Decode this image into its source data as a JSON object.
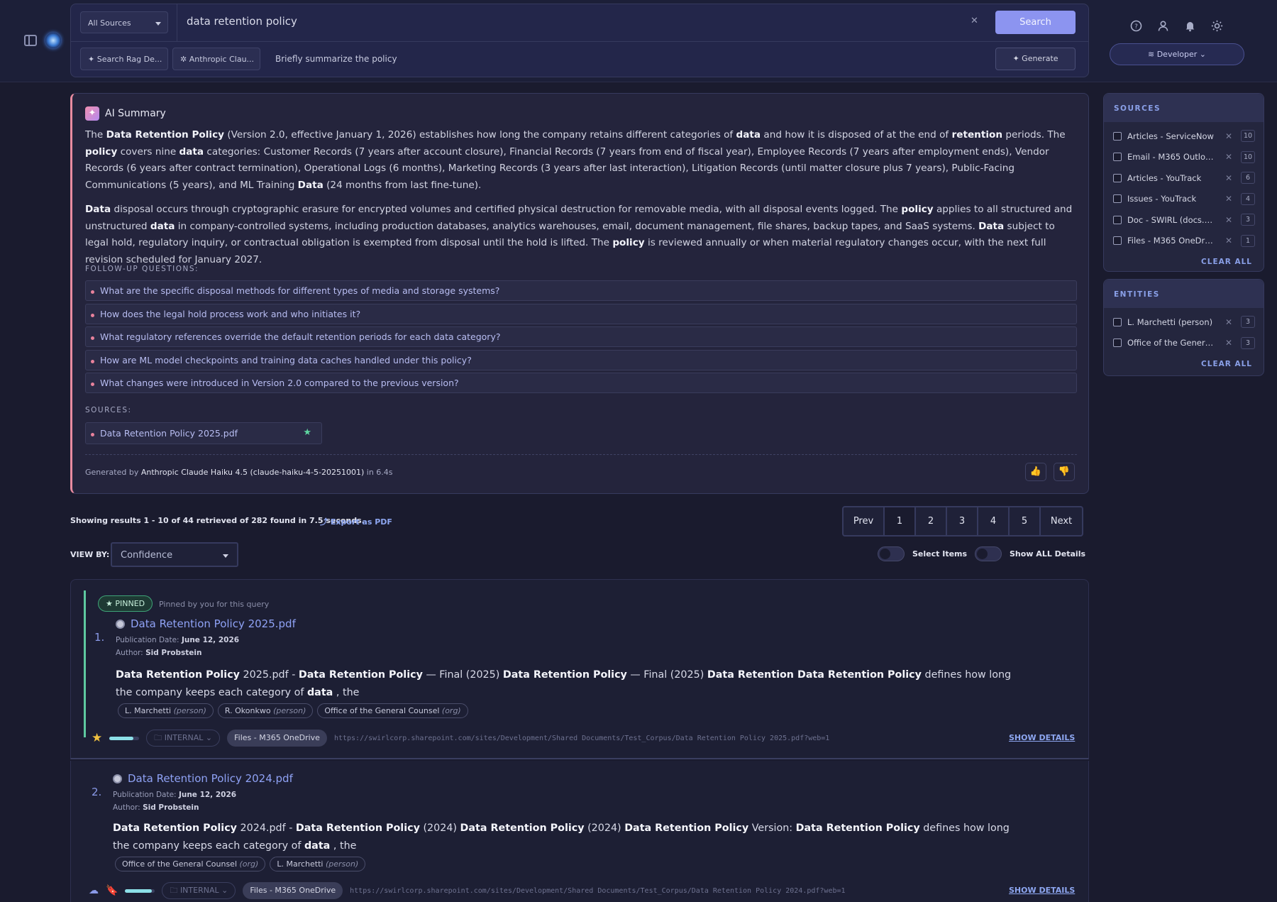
{
  "search": {
    "source_select": "All Sources",
    "query": "data retention policy",
    "clear_icon": "close-icon",
    "search_label": "Search",
    "chips": [
      "Search Rag De...",
      "Anthropic Clau..."
    ],
    "prompt": "Briefly summarize the policy",
    "generate_label": "Generate"
  },
  "header": {
    "icons": [
      "help-icon",
      "user-icon",
      "bell-icon",
      "sun-icon"
    ],
    "developer_label": "Developer"
  },
  "summary": {
    "title": "AI Summary",
    "followup_label": "FOLLOW-UP QUESTIONS:",
    "followups": [
      "What are the specific disposal methods for different types of media and storage systems?",
      "How does the legal hold process work and who initiates it?",
      "What regulatory references override the default retention periods for each data category?",
      "How are ML model checkpoints and training data caches handled under this policy?",
      "What changes were introduced in Version 2.0 compared to the previous version?"
    ],
    "sources_label": "SOURCES:",
    "source_item": "Data Retention Policy 2025.pdf",
    "generated_prefix": "Generated by",
    "generated_model": "Anthropic Claude Haiku 4.5 (claude-haiku-4-5-20251001)",
    "generated_suffix": "in 6.4s"
  },
  "results_bar": {
    "info": "Showing results 1 - 10 of 44 retrieved of 282 found in 7.5 seconds.",
    "export": "Export as PDF",
    "pager": [
      "Prev",
      "1",
      "2",
      "3",
      "4",
      "5",
      "Next"
    ],
    "view_by_label": "VIEW BY:",
    "view_by_value": "Confidence",
    "select_items": "Select Items",
    "show_all": "Show ALL Details"
  },
  "results": [
    {
      "pinned": "PINNED",
      "pinned_note": "Pinned by you for this query",
      "num": "1.",
      "title": "Data Retention Policy 2025.pdf",
      "pub_label": "Publication Date:",
      "pub_date": "June 12, 2026",
      "author_label": "Author:",
      "author": "Sid Probstein",
      "entities": [
        {
          "name": "L. Marchetti",
          "type": "(person)"
        },
        {
          "name": "R. Okonkwo",
          "type": "(person)"
        },
        {
          "name": "Office of the General Counsel",
          "type": "(org)"
        }
      ],
      "progress": 0.8,
      "internal": "INTERNAL",
      "source": "Files - M365 OneDrive",
      "url": "https://swirlcorp.sharepoint.com/sites/Development/Shared Documents/Test_Corpus/Data Retention Policy 2025.pdf?web=1",
      "show_details": "SHOW DETAILS"
    },
    {
      "num": "2.",
      "title": "Data Retention Policy 2024.pdf",
      "pub_label": "Publication Date:",
      "pub_date": "June 12, 2026",
      "author_label": "Author:",
      "author": "Sid Probstein",
      "entities": [
        {
          "name": "Office of the General Counsel",
          "type": "(org)"
        },
        {
          "name": "L. Marchetti",
          "type": "(person)"
        }
      ],
      "progress": 0.9,
      "internal": "INTERNAL",
      "source": "Files - M365 OneDrive",
      "url": "https://swirlcorp.sharepoint.com/sites/Development/Shared Documents/Test_Corpus/Data Retention Policy 2024.pdf?web=1",
      "show_details": "SHOW DETAILS"
    }
  ],
  "sources_panel": {
    "title": "SOURCES",
    "items": [
      {
        "label": "Articles - ServiceNow",
        "count": "10"
      },
      {
        "label": "Email - M365 Outloo...",
        "count": "10"
      },
      {
        "label": "Articles - YouTrack",
        "count": "6"
      },
      {
        "label": "Issues - YouTrack",
        "count": "4"
      },
      {
        "label": "Doc - SWIRL (docs.s...",
        "count": "3"
      },
      {
        "label": "Files - M365 OneDrive",
        "count": "1"
      }
    ],
    "clear_all": "CLEAR ALL"
  },
  "entities_panel": {
    "title": "ENTITIES",
    "items": [
      {
        "label": "L. Marchetti (person)",
        "count": "3"
      },
      {
        "label": "Office of the Genera...",
        "count": "3"
      }
    ],
    "clear_all": "CLEAR ALL"
  },
  "colors": {
    "accent": "#8c94f0",
    "pin_green": "#5ec9a0",
    "summary_border": "#e88ba0"
  }
}
